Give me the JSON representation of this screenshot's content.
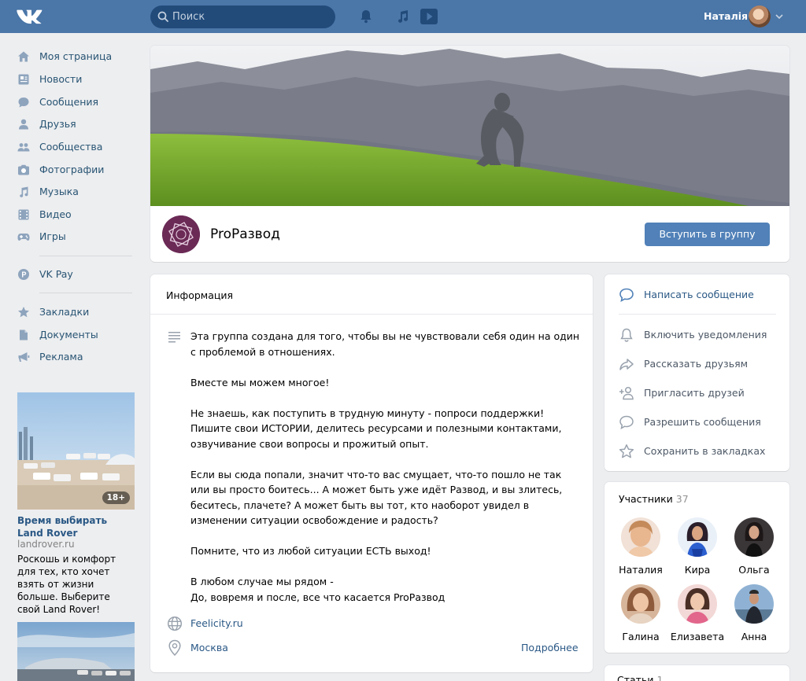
{
  "header": {
    "search_placeholder": "Поиск",
    "user_name": "Наталія"
  },
  "nav": {
    "items": [
      {
        "label": "Моя страница",
        "icon": "home-icon"
      },
      {
        "label": "Новости",
        "icon": "news-icon"
      },
      {
        "label": "Сообщения",
        "icon": "messages-icon"
      },
      {
        "label": "Друзья",
        "icon": "friends-icon"
      },
      {
        "label": "Сообщества",
        "icon": "communities-icon"
      },
      {
        "label": "Фотографии",
        "icon": "camera-icon"
      },
      {
        "label": "Музыка",
        "icon": "music-icon"
      },
      {
        "label": "Видео",
        "icon": "video-icon"
      },
      {
        "label": "Игры",
        "icon": "games-icon"
      },
      {
        "label": "VK Pay",
        "icon": "vkpay-icon"
      },
      {
        "label": "Закладки",
        "icon": "star-icon"
      },
      {
        "label": "Документы",
        "icon": "document-icon"
      },
      {
        "label": "Реклама",
        "icon": "megaphone-icon"
      }
    ]
  },
  "ad": {
    "badge": "18+",
    "title": "Время выбирать Land Rover",
    "domain": "landrover.ru",
    "text": "Роскошь и комфорт для тех, кто хочет взять от жизни больше. Выберите свой Land Rover!"
  },
  "group": {
    "name": "ProРазвод",
    "join_label": "Вступить в группу"
  },
  "info": {
    "title": "Информация",
    "paragraphs": [
      "Эта группа создана для того, чтобы вы не чувствовали себя один на один с проблемой в отношениях.",
      "Вместе мы можем многое!",
      "Не знаешь, как поступить в трудную минуту - попроси поддержки! Пишите свои ИСТОРИИ, делитесь ресурсами и полезными контактами, озвучивание свои вопросы и прожитый опыт.",
      "Если вы сюда попали, значит что-то вас смущает, что-то пошло не так или вы просто боитесь... А может быть уже идёт Развод, и вы злитесь, беситесь, плачете? А может быть вы тот, кто наоборот увидел в изменении ситуации освобождение и радость?",
      "Помните, что из любой ситуации ЕСТЬ выход!",
      "В любом случае мы рядом -\nДо, вовремя и после, все что касается ProРазвод"
    ],
    "website": "Feelicity.ru",
    "city": "Москва",
    "more_label": "Подробнее"
  },
  "actions": {
    "write_message": "Написать сообщение",
    "notifications": "Включить уведомления",
    "share": "Рассказать друзьям",
    "invite": "Пригласить друзей",
    "allow_messages": "Разрешить сообщения",
    "bookmark": "Сохранить в закладках"
  },
  "members": {
    "title": "Участники",
    "count": "37",
    "list": [
      {
        "name": "Наталия"
      },
      {
        "name": "Кира"
      },
      {
        "name": "Ольга"
      },
      {
        "name": "Галина"
      },
      {
        "name": "Елизавета"
      },
      {
        "name": "Анна"
      }
    ]
  },
  "articles": {
    "title": "Статьи",
    "count": "1"
  },
  "colors": {
    "header": "#4a76a8",
    "link": "#2a5885",
    "button": "#5181b8",
    "page_bg": "#edeef0"
  }
}
